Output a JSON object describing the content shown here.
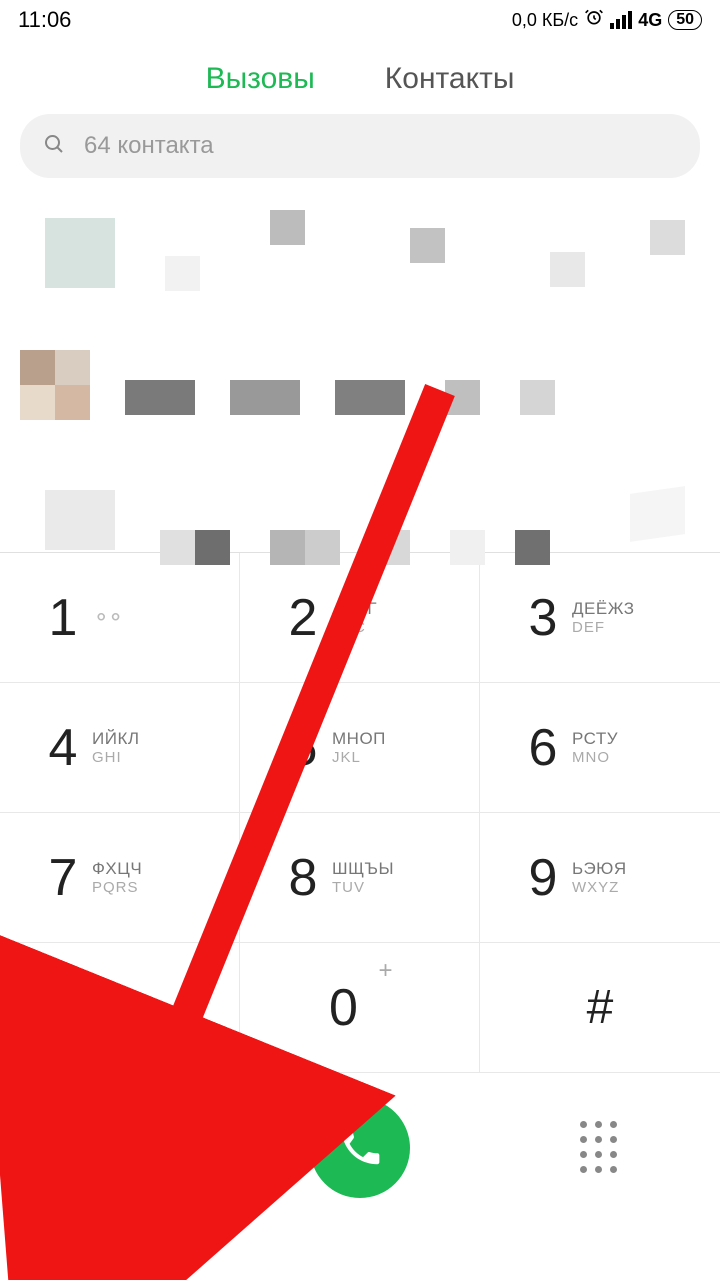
{
  "status": {
    "time": "11:06",
    "data_rate": "0,0 КБ/с",
    "network": "4G",
    "battery": "50"
  },
  "tabs": {
    "calls": "Вызовы",
    "contacts": "Контакты"
  },
  "search": {
    "placeholder": "64 контакта"
  },
  "keys": [
    {
      "digit": "1",
      "ru": "",
      "en": ""
    },
    {
      "digit": "2",
      "ru": "АБВГ",
      "en": "ABC"
    },
    {
      "digit": "3",
      "ru": "ДЕЁЖЗ",
      "en": "DEF"
    },
    {
      "digit": "4",
      "ru": "ИЙКЛ",
      "en": "GHI"
    },
    {
      "digit": "5",
      "ru": "МНОП",
      "en": "JKL"
    },
    {
      "digit": "6",
      "ru": "РСТУ",
      "en": "MNO"
    },
    {
      "digit": "7",
      "ru": "ФХЦЧ",
      "en": "PQRS"
    },
    {
      "digit": "8",
      "ru": "ШЩЪЫ",
      "en": "TUV"
    },
    {
      "digit": "9",
      "ru": "ЬЭЮЯ",
      "en": "WXYZ"
    },
    {
      "digit": "✱",
      "ru": "",
      "en": ""
    },
    {
      "digit": "0",
      "ru": "",
      "en": ""
    },
    {
      "digit": "#",
      "ru": "",
      "en": ""
    }
  ]
}
